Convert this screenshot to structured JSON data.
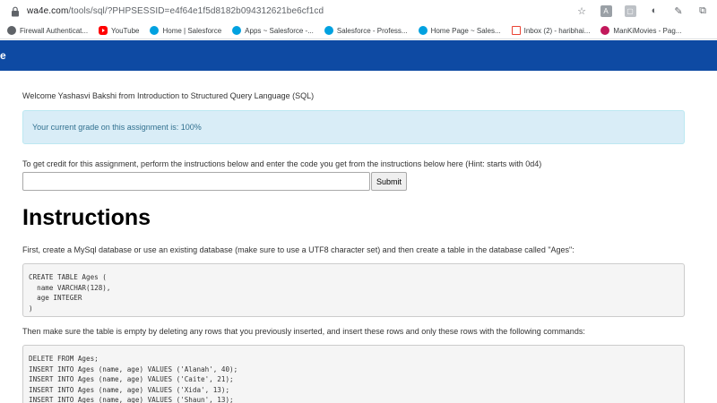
{
  "browser": {
    "url_host": "wa4e.com",
    "url_path": "/tools/sql/?PHPSESSID=e4f64e1f5d8182b094312621be6cf1cd"
  },
  "bookmarks": [
    {
      "label": "Firewall Authenticat...",
      "icon": "globe-icon"
    },
    {
      "label": "YouTube",
      "icon": "youtube-icon"
    },
    {
      "label": "Home | Salesforce",
      "icon": "salesforce-icon"
    },
    {
      "label": "Apps ~ Salesforce -...",
      "icon": "salesforce-icon"
    },
    {
      "label": "Salesforce - Profess...",
      "icon": "salesforce-icon"
    },
    {
      "label": "Home Page ~ Sales...",
      "icon": "salesforce-icon"
    },
    {
      "label": "Inbox (2) - haribhai...",
      "icon": "gmail-icon"
    },
    {
      "label": "ManKiMovies - Pag...",
      "icon": "mankimovies-icon"
    }
  ],
  "header": {
    "brand": "e",
    "color": "#0e4aa3"
  },
  "page": {
    "welcome": "Welcome Yashasvi Bakshi from Introduction to Structured Query Language (SQL)",
    "grade": "Your current grade on this assignment is: 100%",
    "credit_text": "To get credit for this assignment, perform the instructions below and enter the code you get from the instructions below here (Hint: starts with 0d4)",
    "code_input_value": "",
    "submit_label": "Submit",
    "heading": "Instructions",
    "para1": "First, create a MySql database or use an existing database (make sure to use a UTF8 character set) and then create a table in the database called \"Ages\":",
    "code1": [
      "CREATE TABLE Ages (",
      "  name VARCHAR(128),",
      "  age INTEGER",
      ")"
    ],
    "para2": "Then make sure the table is empty by deleting any rows that you previously inserted, and insert these rows and only these rows with the following commands:",
    "code2": [
      "DELETE FROM Ages;",
      "INSERT INTO Ages (name, age) VALUES ('Alanah', 40);",
      "INSERT INTO Ages (name, age) VALUES ('Caite', 21);",
      "INSERT INTO Ages (name, age) VALUES ('Xida', 13);",
      "INSERT INTO Ages (name, age) VALUES ('Shaun', 13);"
    ]
  }
}
